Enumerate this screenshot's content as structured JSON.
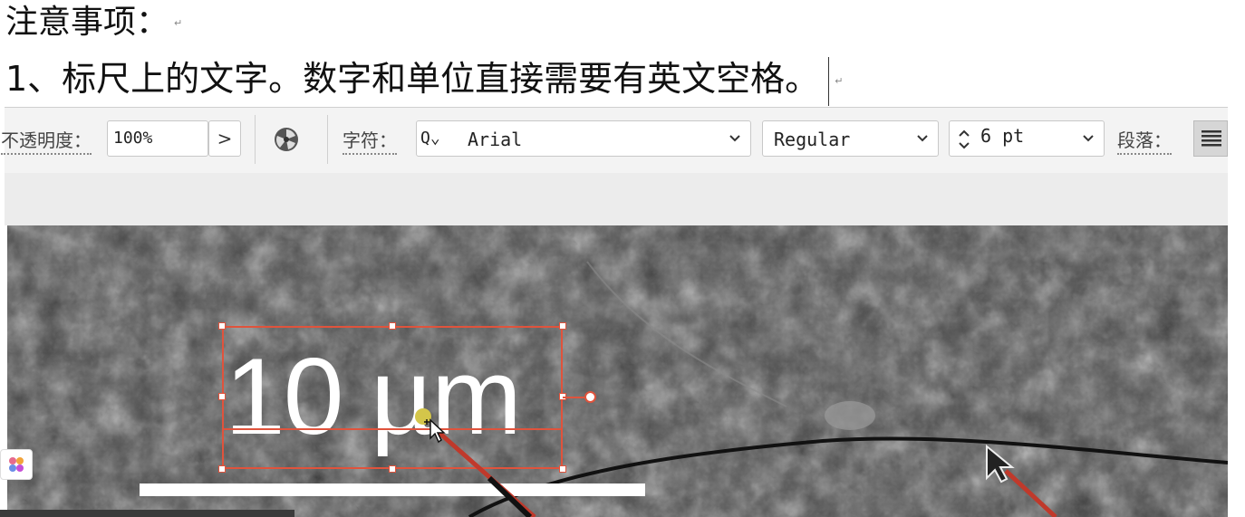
{
  "document": {
    "heading": "注意事项：",
    "rule_1": "1、标尺上的文字。数字和单位直接需要有英文空格。",
    "paragraph_mark": "↵"
  },
  "toolbar": {
    "opacity_label": "不透明度：",
    "opacity_value": "100%",
    "opacity_arrow": ">",
    "character_label": "字符：",
    "font_search_icon": "Q⌄",
    "font_family": "Arial",
    "font_style": "Regular",
    "font_size": "6 pt",
    "paragraph_label": "段落："
  },
  "canvas": {
    "scale_text": "10 µm"
  },
  "colors": {
    "selection": "#e0533c",
    "anchor": "#d4c64a",
    "toolbar_bg": "#f3f3f3"
  },
  "icons": [
    "color-wheel-icon",
    "search-icon",
    "chevron-down-icon",
    "stepper-icon",
    "align-icon",
    "move-cursor-icon",
    "pointer-icon",
    "app-icon"
  ]
}
